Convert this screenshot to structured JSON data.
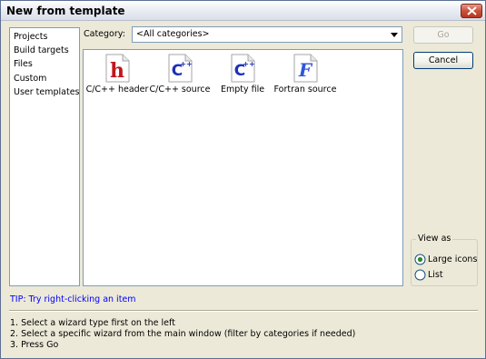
{
  "window": {
    "title": "New from template"
  },
  "categories_list": [
    "Projects",
    "Build targets",
    "Files",
    "Custom",
    "User templates"
  ],
  "category": {
    "label": "Category:",
    "selected": "<All categories>"
  },
  "templates": [
    {
      "label": "C/C++ header",
      "icon": "c-header-file-icon",
      "glyph": "h",
      "color": "#c0161c"
    },
    {
      "label": "C/C++ source",
      "icon": "cpp-source-file-icon",
      "glyph": "C++",
      "color": "#1c2fb8"
    },
    {
      "label": "Empty file",
      "icon": "empty-file-icon",
      "glyph": "C++",
      "color": "#1c2fb8"
    },
    {
      "label": "Fortran source",
      "icon": "fortran-source-file-icon",
      "glyph": "F",
      "color": "#2f55d9"
    }
  ],
  "buttons": {
    "go": "Go",
    "cancel": "Cancel"
  },
  "view_as": {
    "legend": "View as",
    "options": [
      "Large icons",
      "List"
    ],
    "selected": "Large icons"
  },
  "tip": "TIP: Try right-clicking an item",
  "instructions": [
    "1. Select a wizard type first on the left",
    "2. Select a specific wizard from the main window (filter by categories if needed)",
    "3. Press Go"
  ]
}
